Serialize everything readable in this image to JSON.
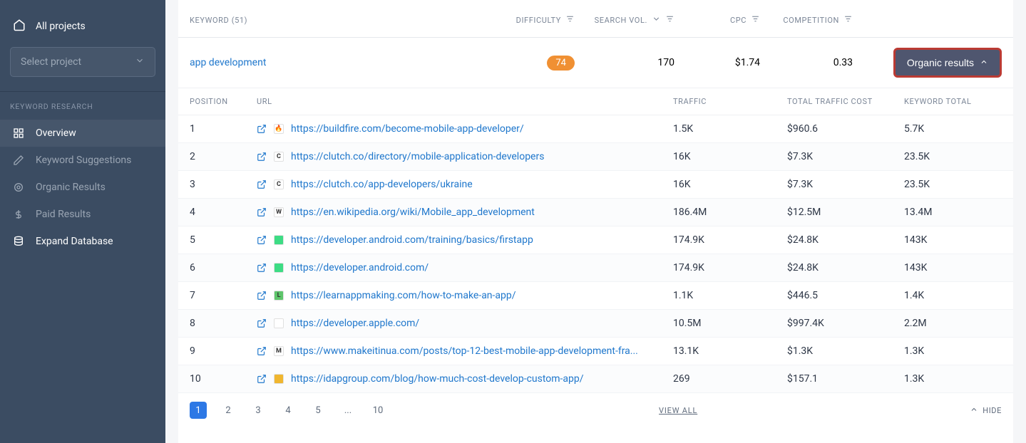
{
  "sidebar": {
    "all_projects": "All projects",
    "select_placeholder": "Select project",
    "section_title": "KEYWORD RESEARCH",
    "items": [
      {
        "label": "Overview",
        "active": true,
        "white": false
      },
      {
        "label": "Keyword Suggestions",
        "active": false,
        "white": false
      },
      {
        "label": "Organic Results",
        "active": false,
        "white": false
      },
      {
        "label": "Paid Results",
        "active": false,
        "white": false
      },
      {
        "label": "Expand Database",
        "active": false,
        "white": true
      }
    ]
  },
  "header": {
    "keyword": "KEYWORD  (51)",
    "difficulty": "DIFFICULTY",
    "search_vol": "SEARCH VOL.",
    "cpc": "CPC",
    "competition": "COMPETITION"
  },
  "keyword_row": {
    "keyword": "app development",
    "difficulty": "74",
    "search_vol": "170",
    "cpc": "$1.74",
    "competition": "0.33",
    "organic_btn": "Organic results"
  },
  "sub_header": {
    "position": "POSITION",
    "url": "URL",
    "traffic": "TRAFFIC",
    "traffic_cost": "TOTAL TRAFFIC COST",
    "keyword_total": "KEYWORD TOTAL"
  },
  "results": [
    {
      "pos": "1",
      "url": "https://buildfire.com/become-mobile-app-developer/",
      "traffic": "1.5K",
      "cost": "$960.6",
      "total": "5.7K",
      "favcolor": "#ffffff",
      "favtext": "🔥"
    },
    {
      "pos": "2",
      "url": "https://clutch.co/directory/mobile-application-developers",
      "traffic": "16K",
      "cost": "$7.3K",
      "total": "23.5K",
      "favcolor": "#ffffff",
      "favtext": "C"
    },
    {
      "pos": "3",
      "url": "https://clutch.co/app-developers/ukraine",
      "traffic": "16K",
      "cost": "$7.3K",
      "total": "23.5K",
      "favcolor": "#ffffff",
      "favtext": "C"
    },
    {
      "pos": "4",
      "url": "https://en.wikipedia.org/wiki/Mobile_app_development",
      "traffic": "186.4M",
      "cost": "$12.5M",
      "total": "13.4M",
      "favcolor": "#ffffff",
      "favtext": "W"
    },
    {
      "pos": "5",
      "url": "https://developer.android.com/training/basics/firstapp",
      "traffic": "174.9K",
      "cost": "$24.8K",
      "total": "143K",
      "favcolor": "#3ddc84",
      "favtext": ""
    },
    {
      "pos": "6",
      "url": "https://developer.android.com/",
      "traffic": "174.9K",
      "cost": "$24.8K",
      "total": "143K",
      "favcolor": "#3ddc84",
      "favtext": ""
    },
    {
      "pos": "7",
      "url": "https://learnappmaking.com/how-to-make-an-app/",
      "traffic": "1.1K",
      "cost": "$446.5",
      "total": "1.4K",
      "favcolor": "#5ec56b",
      "favtext": "L"
    },
    {
      "pos": "8",
      "url": "https://developer.apple.com/",
      "traffic": "10.5M",
      "cost": "$997.4K",
      "total": "2.2M",
      "favcolor": "#ffffff",
      "favtext": ""
    },
    {
      "pos": "9",
      "url": "https://www.makeitinua.com/posts/top-12-best-mobile-app-development-fra...",
      "traffic": "13.1K",
      "cost": "$1.3K",
      "total": "1.3K",
      "favcolor": "#ffffff",
      "favtext": "M"
    },
    {
      "pos": "10",
      "url": "https://idapgroup.com/blog/how-much-cost-develop-custom-app/",
      "traffic": "269",
      "cost": "$157.1",
      "total": "1.3K",
      "favcolor": "#f0b62f",
      "favtext": ""
    }
  ],
  "pagination": {
    "pages": [
      "1",
      "2",
      "3",
      "4",
      "5",
      "...",
      "10"
    ],
    "view_all": "VIEW ALL",
    "hide": "HIDE"
  }
}
